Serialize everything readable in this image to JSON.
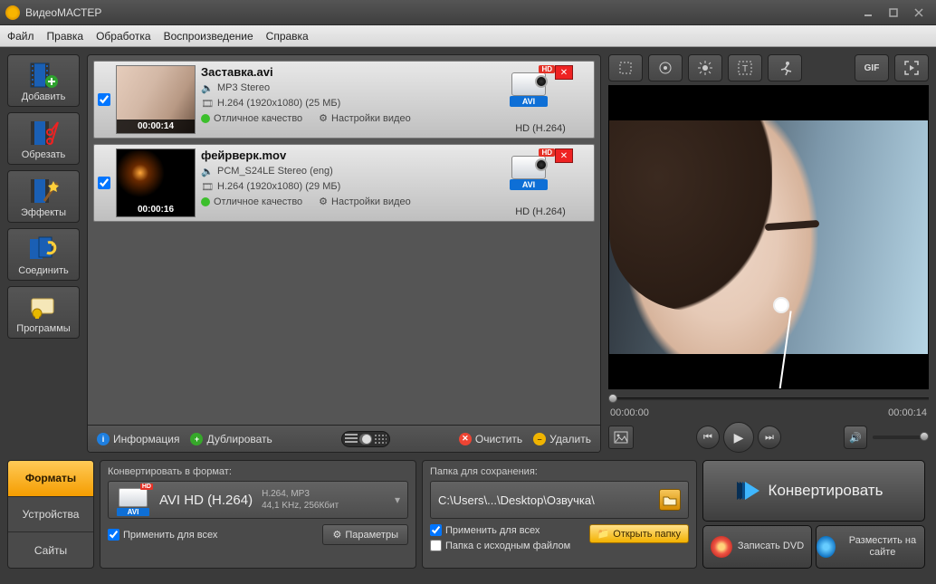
{
  "window": {
    "title": "ВидеоМАСТЕР"
  },
  "menu": {
    "file": "Файл",
    "edit": "Правка",
    "process": "Обработка",
    "playback": "Воспроизведение",
    "help": "Справка"
  },
  "toolbar": {
    "add": "Добавить",
    "cut": "Обрезать",
    "effects": "Эффекты",
    "join": "Соединить",
    "programs": "Программы"
  },
  "files": [
    {
      "name": "Заставка.avi",
      "duration": "00:00:14",
      "audio": "MP3 Stereo",
      "video": "H.264 (1920x1080) (25 МБ)",
      "quality": "Отличное качество",
      "settings": "Настройки видео",
      "target_format": "AVI",
      "target_badge": "HD",
      "target_codec": "HD (H.264)",
      "checked": true,
      "thumb": "face"
    },
    {
      "name": "фейрверк.mov",
      "duration": "00:00:16",
      "audio": "PCM_S24LE Stereo (eng)",
      "video": "H.264 (1920x1080) (29 МБ)",
      "quality": "Отличное качество",
      "settings": "Настройки видео",
      "target_format": "AVI",
      "target_badge": "HD",
      "target_codec": "HD (H.264)",
      "checked": true,
      "thumb": "fire"
    }
  ],
  "list_actions": {
    "info": "Информация",
    "dup": "Дублировать",
    "clear": "Очистить",
    "delete": "Удалить"
  },
  "preview": {
    "time_cur": "00:00:00",
    "time_total": "00:00:14"
  },
  "bottom_tabs": {
    "formats": "Форматы",
    "devices": "Устройства",
    "sites": "Сайты"
  },
  "format_panel": {
    "label": "Конвертировать в формат:",
    "selected_name": "AVI HD (H.264)",
    "selected_det1": "H.264, MP3",
    "selected_det2": "44,1 KHz, 256Кбит",
    "selected_badge": "HD",
    "selected_fmt": "AVI",
    "apply_all": "Применить для всех",
    "params": "Параметры"
  },
  "save_panel": {
    "label": "Папка для сохранения:",
    "path": "C:\\Users\\...\\Desktop\\Озвучка\\",
    "apply_all": "Применить для всех",
    "source_folder": "Папка с исходным файлом",
    "open_folder": "Открыть папку"
  },
  "actions": {
    "convert": "Конвертировать",
    "burn": "Записать DVD",
    "publish": "Разместить на сайте"
  },
  "ptool": {
    "gif": "GIF"
  }
}
